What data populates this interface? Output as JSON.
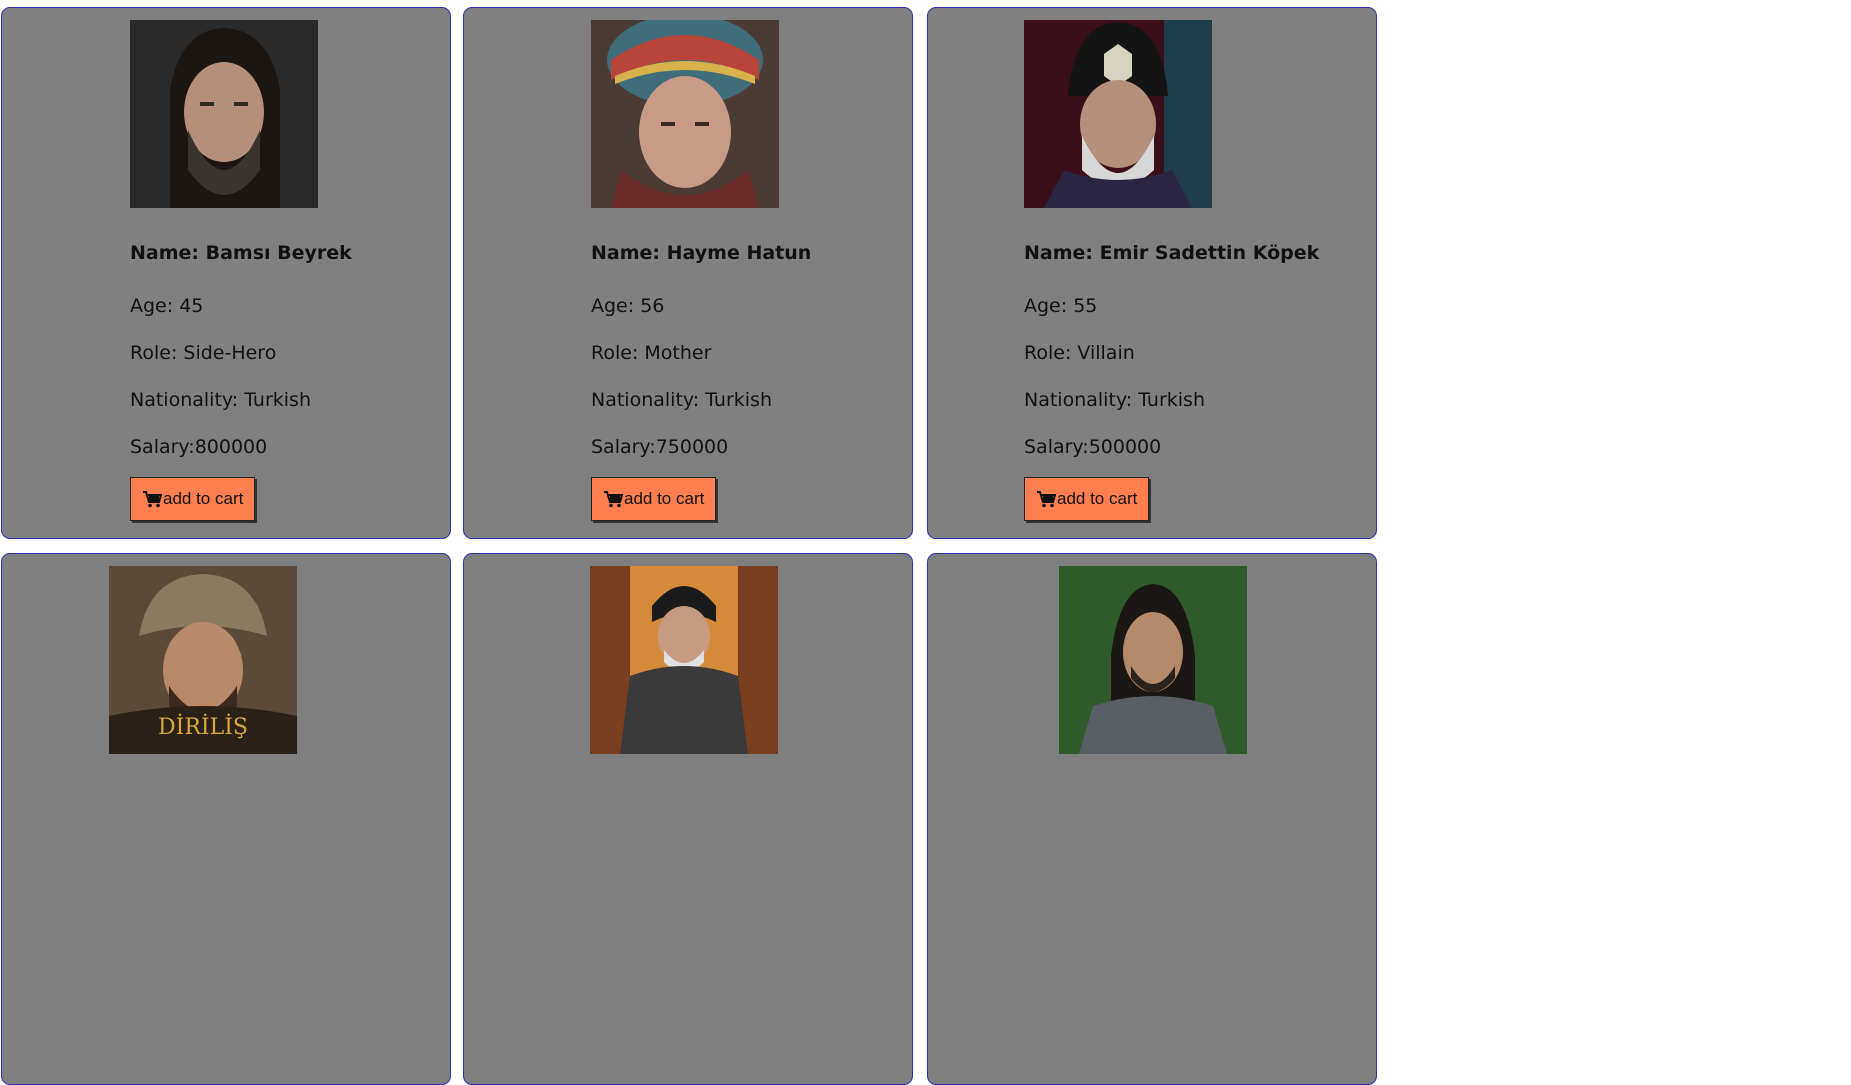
{
  "button_label": "add to cart",
  "accent": "#ff7f50",
  "card_bg": "#808080",
  "cards": [
    {
      "name": "Name: Bamsı Beyrek",
      "age": "Age: 45",
      "role": "Role: Side-Hero",
      "nationality": "Nationality: Turkish",
      "salary": "Salary:800000",
      "photo": "man-long-hair-beard-photo"
    },
    {
      "name": "Name: Hayme Hatun",
      "age": "Age: 56",
      "role": "Role: Mother",
      "nationality": "Nationality: Turkish",
      "salary": "Salary:750000",
      "photo": "woman-headscarf-photo"
    },
    {
      "name": "Name: Emir Sadettin Köpek",
      "age": "Age: 55",
      "role": "Role: Villain",
      "nationality": "Nationality: Turkish",
      "salary": "Salary:500000",
      "photo": "man-turban-grey-beard-photo"
    },
    {
      "photo": "man-fur-hat-photo",
      "poster_text": "DİRİLİŞ"
    },
    {
      "photo": "man-black-turban-armor-photo"
    },
    {
      "photo": "man-long-hair-forest-photo"
    }
  ]
}
